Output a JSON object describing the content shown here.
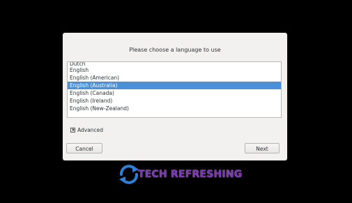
{
  "dialog": {
    "prompt": "Please choose a language to use",
    "languages": [
      "Dutch",
      "English",
      "English (American)",
      "English (Australia)",
      "English (Canada)",
      "English (Ireland)",
      "English (New-Zealand)"
    ],
    "selected_language": "English (Australia)",
    "advanced_label": "Advanced",
    "cancel_label": "Cancel",
    "next_label": "Next"
  },
  "watermark": {
    "text": "TECH REFRESHING",
    "text_color": "#7b35b8",
    "icon": "refresh-arrows-icon",
    "icon_color": "#2f7fd8"
  },
  "colors": {
    "selection": "#4a90d9",
    "background": "#000000",
    "dialog": "#f2f1f0"
  }
}
